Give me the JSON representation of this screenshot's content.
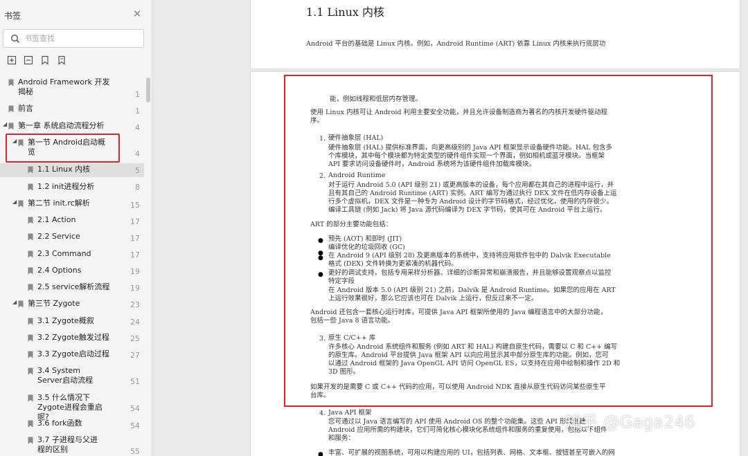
{
  "sidebar": {
    "title": "书签",
    "search_placeholder": "书签查找",
    "tree": [
      {
        "label": "Android Framework 开发揭秘",
        "page": "1"
      },
      {
        "label": "前言",
        "page": "1"
      },
      {
        "label": "第一章  系统启动流程分析",
        "page": "4"
      },
      {
        "label": "第一节 Android启动概览",
        "page": "4"
      },
      {
        "label": "1.1 Linux 内核",
        "page": "5"
      },
      {
        "label": "1.2 init进程分析",
        "page": "8"
      },
      {
        "label": "第二节 init.rc解析",
        "page": "15"
      },
      {
        "label": "2.1 Action",
        "page": "17"
      },
      {
        "label": "2.2 Service",
        "page": "17"
      },
      {
        "label": "2.3 Command",
        "page": "17"
      },
      {
        "label": "2.4 Options",
        "page": "19"
      },
      {
        "label": "2.5 service解析流程",
        "page": "19"
      },
      {
        "label": "第三节 Zygote",
        "page": "23"
      },
      {
        "label": "3.1 Zygote概叙",
        "page": "24"
      },
      {
        "label": "3.2 Zygote触发过程",
        "page": "25"
      },
      {
        "label": "3.3 Zygote启动过程",
        "page": "27"
      },
      {
        "label": "3.4 System Server启动流程",
        "page": "51"
      },
      {
        "label": "3.5 什么情况下Zygote进程会重启呢?",
        "page": "54"
      },
      {
        "label": "3.6 fork函数",
        "page": "54"
      },
      {
        "label": "3.7 子进程与父进程的区别",
        "page": "55"
      }
    ]
  },
  "document": {
    "section_title": "1.1 Linux 内核",
    "page1_text": "Android 平台的基础是 Linux 内核。例如，Android Runtime (ART) 依靠 Linux 内核来执行底层功",
    "l01": "能，例如线程和低层内存管理。",
    "l02": "使用 Linux 内核可让 Android 利用主要安全功能，并且允许设备制造商为著名的内核开发硬件驱动程",
    "l03": "序。",
    "n1": "1.",
    "l04": "硬件抽象层 (HAL)",
    "l05": "硬件抽象层 (HAL) 提供标准界面，向更高级别的 Java API 框架显示设备硬件功能。HAL 包含多",
    "l06": "个库模块，其中每个模块都为特定类型的硬件组件实现一个界面，例如相机或蓝牙模块。当框架",
    "l07": "API 要求访问设备硬件时，Android 系统将为该硬件组件加载库模块。",
    "n2": "2.",
    "l08": "Android Runtime",
    "l09": "对于运行 Android 5.0 (API 级别 21) 或更高版本的设备，每个应用都在其自己的进程中运行，并",
    "l10": "且有其自己的 Android Runtime (ART) 实例。ART 编写为通过执行 DEX 文件在低内存设备上运",
    "l11": "行多个虚拟机，DEX 文件是一种专为 Android 设计的字节码格式，经过优化，使用的内存很少。",
    "l12": "编译工具链 (例如 Jack) 将 Java 源代码编译为 DEX 字节码，使其可在 Android 平台上运行。",
    "l13": "ART 的部分主要功能包括：",
    "l14": "预先 (AOT) 和即时 (JIT)",
    "l15": "编译优化的垃圾回收 (GC)",
    "l16": "在 Android 9 (API 级别 28) 及更高版本的系统中，支持将应用软件包中的 Dalvik Executable",
    "l17": "格式 (DEX) 文件转换为更紧凑的机器代码。",
    "l18": "更好的调试支持，包括专用采样分析器、详细的诊断异常和崩溃报告，并且能够设置观察点以监控",
    "l19": "特定字段",
    "l20": "在 Android 版本 5.0 (API 级别 21) 之前，Dalvik 是 Android Runtime。如果您的应用在 ART",
    "l21": "上运行效果很好，那么它应该也可在 Dalvik 上运行，但反过来不一定。",
    "l22": "Android 还包含一套核心运行时库，可提供 Java API 框架所使用的 Java 编程语言中的大部分功能，",
    "l23": "包括一些 Java 8 语言功能。",
    "n3": "3.",
    "l24": "原生 C/C++ 库",
    "l25": "许多核心 Android 系统组件和服务 (例如 ART 和 HAL) 构建自原生代码，需要以 C 和 C++ 编写",
    "l26": "的原生库。Android 平台提供 Java 框架 API 以向应用显示其中部分原生库的功能。例如，您可",
    "l27": "以通过 Android 框架的 Java OpenGL API 访问 OpenGL ES，以支持在应用中绘制和操作 2D 和",
    "l28": "3D 图形。",
    "l29": "如果开发的是需要 C 或 C++ 代码的应用，可以使用 Android NDK 直接从原生代码访问某些原生平",
    "l30": "台库。",
    "n4": "4.",
    "l31": "Java API 框架",
    "l32": "您可通过以 Java 语言编写的 API 使用 Android OS 的整个功能集。这些 API 形成创建",
    "l33": "Android 应用所需的构建块，它们可简化核心模块化系统组件和服务的重复使用，包括以下组件",
    "l34": "和服务：",
    "l35": "丰富、可扩展的视图系统，可用以构建应用的 UI，包括列表、网格、文本框、按钮甚至可嵌入的网",
    "watermark": "知乎 @Gaga246"
  }
}
